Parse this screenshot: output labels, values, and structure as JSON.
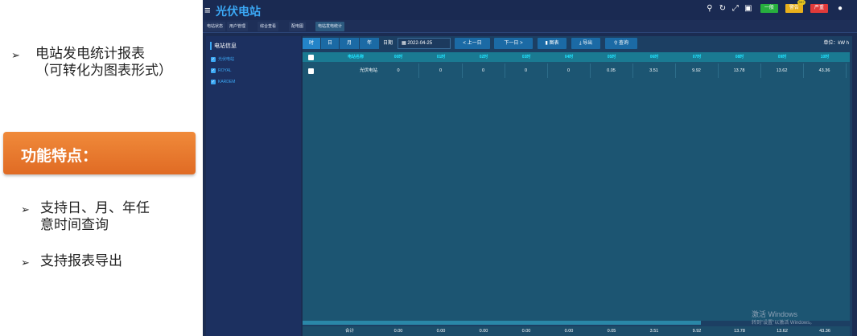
{
  "slide": {
    "bullet1_line1": "电站发电统计报表",
    "bullet1_line2": "（可转化为图表形式）",
    "feature_title": "功能特点：",
    "bullet2_line1": "支持日、月、年任",
    "bullet2_line2": "意时间查询",
    "bullet3": "支持报表导出",
    "arrow": "➢"
  },
  "app": {
    "title": "光伏电站",
    "badges": {
      "green": "一般",
      "yellow": "警告",
      "yellow_dot": "99+",
      "red": "严重"
    },
    "tabs": [
      "电站状态",
      "用户管理",
      "综合查看",
      "配电图",
      "电站发电统计"
    ],
    "sidebar": {
      "title": "电站信息",
      "items": [
        "光伏电站",
        "ROYAL",
        "KARDEM"
      ]
    },
    "toolbar": {
      "segments": [
        "时",
        "日",
        "月",
        "年"
      ],
      "date_label": "日期",
      "date_value": "2022-04-25",
      "prev_btn": "< 上一日",
      "next_btn": "下一日 >",
      "chart_btn": "图表",
      "export_btn": "导出",
      "query_btn": "查询",
      "unit": "单位：kW h"
    },
    "table": {
      "headers": [
        "电站名称",
        "00时",
        "01时",
        "02时",
        "03时",
        "04时",
        "05时",
        "06时",
        "07时",
        "08时",
        "09时",
        "10时"
      ],
      "rows": [
        [
          "光伏电站",
          "0",
          "0",
          "0",
          "0",
          "0",
          "0.05",
          "3.51",
          "9.92",
          "13.78",
          "13.62",
          "43.36"
        ]
      ],
      "footer": [
        "合计",
        "0.00",
        "0.00",
        "0.00",
        "0.00",
        "0.00",
        "0.05",
        "3.51",
        "9.92",
        "13.78",
        "13.62",
        "43.36"
      ]
    },
    "watermark": {
      "line1": "激活 Windows",
      "line2": "转到\"设置\"以激活 Windows。"
    }
  },
  "colors": {
    "accent": "#3ba8f5",
    "orange": "#e8782e",
    "header_text": "#1fe3ff"
  }
}
